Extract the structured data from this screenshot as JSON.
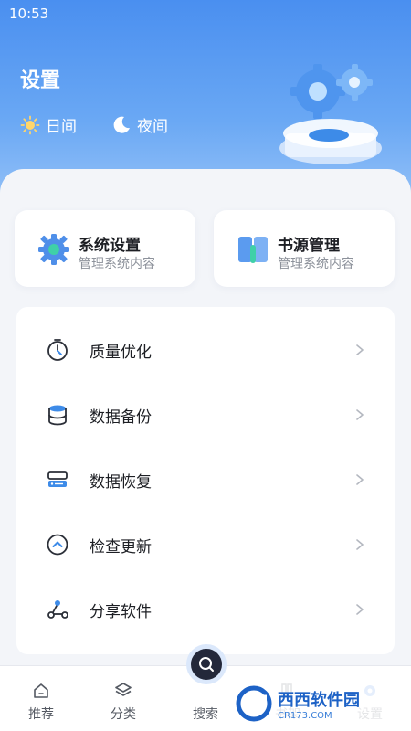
{
  "status_bar": {
    "time": "10:53"
  },
  "header": {
    "title": "设置",
    "day_mode_label": "日间",
    "night_mode_label": "夜间"
  },
  "quick_cards": [
    {
      "title": "系统设置",
      "subtitle": "管理系统内容",
      "icon": "gear-icon"
    },
    {
      "title": "书源管理",
      "subtitle": "管理系统内容",
      "icon": "book-icon"
    }
  ],
  "menu": {
    "items": [
      {
        "label": "质量优化",
        "icon": "timer-icon"
      },
      {
        "label": "数据备份",
        "icon": "database-icon"
      },
      {
        "label": "数据恢复",
        "icon": "server-icon"
      },
      {
        "label": "检查更新",
        "icon": "chevron-up-circle-icon"
      },
      {
        "label": "分享软件",
        "icon": "share-icon"
      }
    ]
  },
  "tabbar": {
    "tabs": [
      {
        "label": "推荐",
        "icon": "home-icon"
      },
      {
        "label": "分类",
        "icon": "layers-icon"
      },
      {
        "label": "搜索",
        "icon": "search-icon"
      },
      {
        "label": "书架",
        "icon": "bookshelf-icon"
      },
      {
        "label": "设置",
        "icon": "gear-icon"
      }
    ]
  },
  "watermark": {
    "brand": "西西软件园",
    "site": "CR173.COM"
  },
  "colors": {
    "accent": "#4a8ff0",
    "header_top": "#4a8ff0",
    "header_bottom": "#9cc6f8",
    "page_bg": "#f3f5f9",
    "text_primary": "#1d1f24",
    "text_secondary": "#8d929b"
  }
}
